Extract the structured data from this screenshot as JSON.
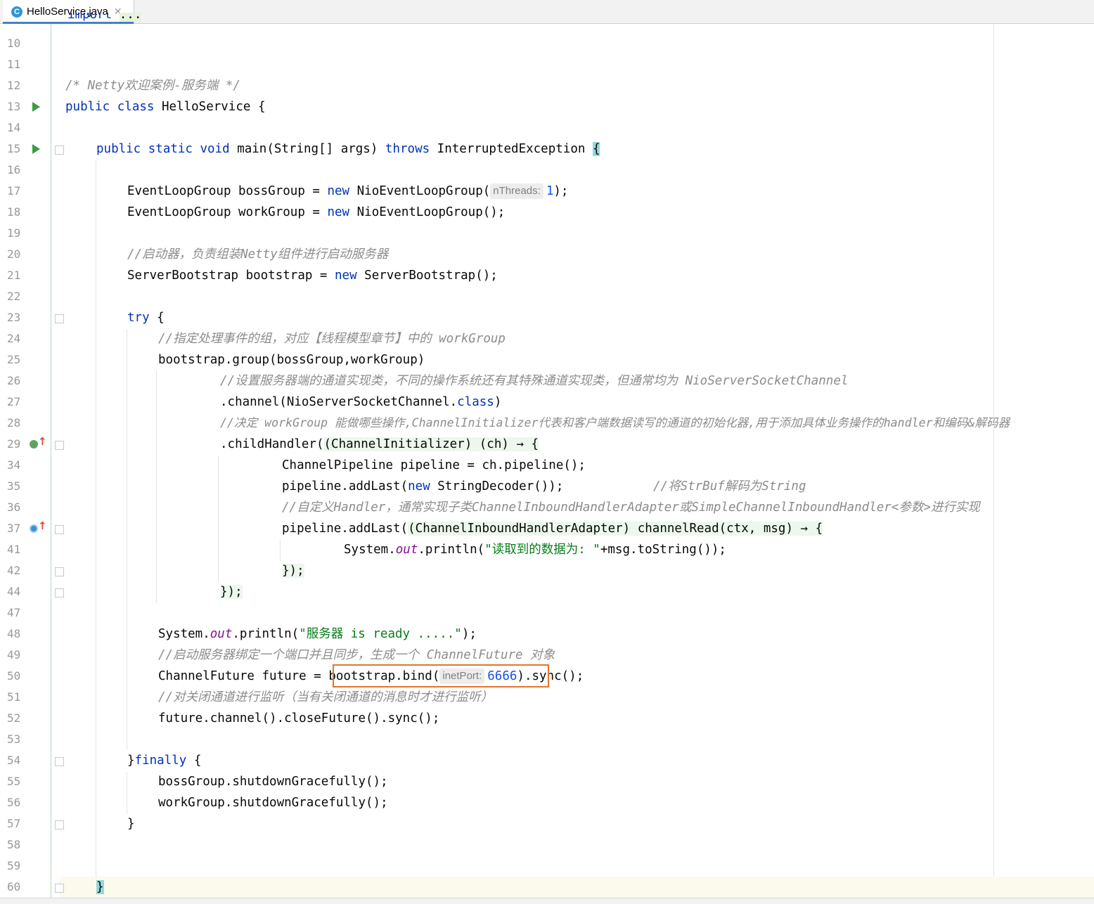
{
  "tab": {
    "filename": "HelloService.java",
    "icon": "java-class-icon",
    "icon_letter": "C"
  },
  "lines": [
    {
      "n": "10",
      "y": 0
    },
    {
      "n": "11"
    },
    {
      "n": "12"
    },
    {
      "n": "13"
    },
    {
      "n": "14"
    },
    {
      "n": "15"
    },
    {
      "n": "16"
    },
    {
      "n": "17"
    },
    {
      "n": "18"
    },
    {
      "n": "19"
    },
    {
      "n": "20"
    },
    {
      "n": "21"
    },
    {
      "n": "22"
    },
    {
      "n": "23"
    },
    {
      "n": "24"
    },
    {
      "n": "25"
    },
    {
      "n": "26"
    },
    {
      "n": "27"
    },
    {
      "n": "28"
    },
    {
      "n": "29"
    },
    {
      "n": "34"
    },
    {
      "n": "35"
    },
    {
      "n": "36"
    },
    {
      "n": "37"
    },
    {
      "n": "41"
    },
    {
      "n": "42"
    },
    {
      "n": "44"
    },
    {
      "n": "47"
    },
    {
      "n": "48"
    },
    {
      "n": "49"
    },
    {
      "n": "50"
    },
    {
      "n": "51"
    },
    {
      "n": "52"
    },
    {
      "n": "53"
    },
    {
      "n": "54"
    },
    {
      "n": "55"
    },
    {
      "n": "56"
    },
    {
      "n": "57"
    },
    {
      "n": "58"
    },
    {
      "n": "59"
    },
    {
      "n": "60"
    }
  ],
  "code": {
    "l0": "import ...",
    "l12": "/* Netty欢迎案例-服务端 */",
    "l13_kw": "public class",
    "l13_rest": " HelloService {",
    "l15_kw": "public static void",
    "l15_mid": " main(String[] args) ",
    "l15_throws": "throws",
    "l15_rest": " InterruptedException ",
    "l15_brace": "{",
    "l17_a": "EventLoopGroup bossGroup = ",
    "l17_new": "new",
    "l17_b": " NioEventLoopGroup(",
    "l17_hint": "nThreads:",
    "l17_num": "1",
    "l17_c": ");",
    "l18_a": "EventLoopGroup workGroup = ",
    "l18_new": "new",
    "l18_b": " NioEventLoopGroup();",
    "l20": "//启动器，负责组装Netty组件进行启动服务器",
    "l21_a": "ServerBootstrap bootstrap = ",
    "l21_new": "new",
    "l21_b": " ServerBootstrap();",
    "l23_kw": "try",
    "l23_b": " {",
    "l24": "//指定处理事件的组，对应【线程模型章节】中的 workGroup",
    "l25": "bootstrap.group(bossGroup,workGroup)",
    "l26": "//设置服务器端的通道实现类，不同的操作系统还有其特殊通道实现类，但通常均为 NioServerSocketChannel",
    "l27_a": ".channel(NioServerSocketChannel.",
    "l27_kw": "class",
    "l27_b": ")",
    "l28": "//决定 workGroup 能做哪些操作,ChannelInitializer代表和客户端数据读写的通道的初始化器,用于添加具体业务操作的handler和编码&解码器",
    "l29_a": ".childHandler(",
    "l29_b": "(ChannelInitializer) (ch) → {",
    "l34": "ChannelPipeline pipeline = ch.pipeline();",
    "l35_a": "pipeline.addLast(",
    "l35_new": "new",
    "l35_b": " StringDecoder());",
    "l35_cm": "//将StrBuf解码为String",
    "l36": "//自定义Handler，通常实现子类ChannelInboundHandlerAdapter或SimpleChannelInboundHandler<参数>进行实现",
    "l37_a": "pipeline.addLast(",
    "l37_b": "(ChannelInboundHandlerAdapter) channelRead(ctx, msg) → {",
    "l41_a": "System.",
    "l41_out": "out",
    "l41_b": ".println(",
    "l41_str": "\"读取到的数据为: \"",
    "l41_c": "+msg.toString());",
    "l42": "});",
    "l44": "});",
    "l48_a": "System.",
    "l48_out": "out",
    "l48_b": ".println(",
    "l48_str": "\"服务器 is ready .....\"",
    "l48_c": ");",
    "l49": "//启动服务器绑定一个端口并且同步，生成一个 ChannelFuture 对象",
    "l50_a": "ChannelFuture future = ",
    "l50_b": "bootstrap.bind(",
    "l50_hint": "inetPort:",
    "l50_num": "6666",
    "l50_c": ")",
    "l50_d": ".sync();",
    "l51": "//对关闭通道进行监听（当有关闭通道的消息时才进行监听）",
    "l52": "future.channel().closeFuture().sync();",
    "l54_a": "}",
    "l54_kw": "finally",
    "l54_b": " {",
    "l55": "bossGroup.shutdownGracefully();",
    "l56": "workGroup.shutdownGracefully();",
    "l57": "}",
    "l60": "}"
  },
  "colors": {
    "keyword": "#0033b3",
    "comment": "#8c8c8c",
    "string": "#067d17",
    "number": "#1750eb",
    "highlight_box": "#e0762e"
  }
}
